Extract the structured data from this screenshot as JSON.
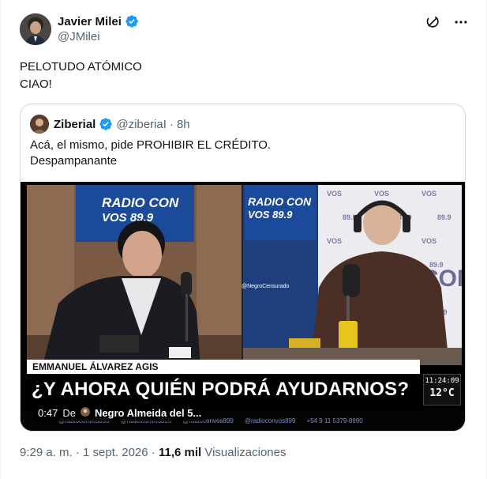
{
  "author": {
    "name": "Javier Milei",
    "handle": "@JMilei"
  },
  "tweet": {
    "lines": [
      "PELOTUDO ATÓMICO",
      "CIAO!"
    ]
  },
  "quoted": {
    "name": "Ziberial",
    "handle": "@ziberiaI",
    "time": "8h",
    "lines": [
      "Acá, el mismo, pide PROHIBIR EL CRÉDITO.",
      "Despampanante"
    ],
    "video": {
      "guest_name": "EMMANUEL ÁLVAREZ AGIS",
      "headline": "¿Y AHORA QUIÉN PODRÁ AYUDARNOS?",
      "clock_time": "11:24:09",
      "temperature": "12°C",
      "station_sign": "RADIO CON VOS 89.9",
      "watermark": "@NegroCensurado",
      "socials": [
        "@radioconvos899",
        "@radioconvos899",
        "@radioconvos899",
        "@radioconvos899",
        "+54 9 11 5379-8990"
      ],
      "timecode": "0:47",
      "by_label": "De",
      "uploader": "Negro Almeida del 5..."
    }
  },
  "footer": {
    "time": "9:29 a. m.",
    "date": "1 sept. 2026",
    "separator": "·",
    "views_count": "11,6 mil",
    "views_label": "Visualizaciones"
  },
  "colors": {
    "verified": "#1d9bf0",
    "secondary_text": "#536471",
    "border": "#cfd9de"
  },
  "icons": [
    "verified-badge-icon",
    "grok-icon",
    "more-icon"
  ]
}
